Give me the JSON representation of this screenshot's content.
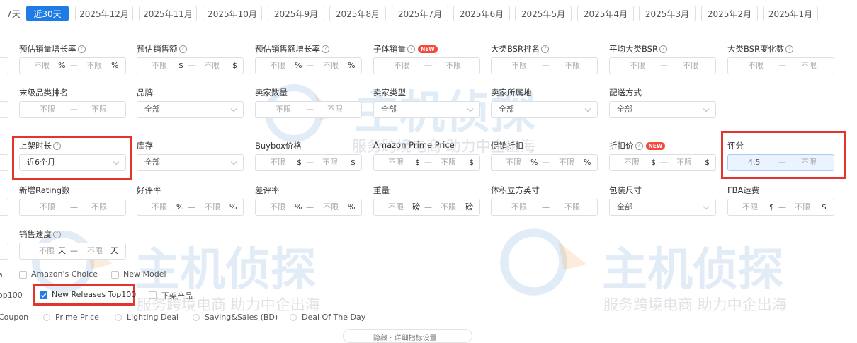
{
  "tabs": [
    "7天",
    "近30天",
    "2025年12月",
    "2025年11月",
    "2025年10月",
    "2025年9月",
    "2025年8月",
    "2025年7月",
    "2025年6月",
    "2025年5月",
    "2025年4月",
    "2025年3月",
    "2025年2月",
    "2025年1月"
  ],
  "active_tab": "近30天",
  "placeholder": "不限",
  "range_dash": "—",
  "placeholder_all": "全部",
  "new_badge": "NEW",
  "filters": {
    "sales_growth_rate": {
      "label": "预估销量增长率",
      "unit": "%"
    },
    "est_revenue": {
      "label": "预估销售额",
      "unit": "$"
    },
    "revenue_growth_rate": {
      "label": "预估销售额增长率",
      "unit": "%"
    },
    "child_sales": {
      "label": "子体销量"
    },
    "main_bsr_rank": {
      "label": "大类BSR排名"
    },
    "avg_main_bsr": {
      "label": "平均大类BSR"
    },
    "main_bsr_change": {
      "label": "大类BSR变化数"
    },
    "leaf_category_rank": {
      "label": "末级品类排名"
    },
    "brand": {
      "label": "品牌"
    },
    "seller_count": {
      "label": "卖家数量"
    },
    "seller_type": {
      "label": "卖家类型"
    },
    "seller_location": {
      "label": "卖家所属地"
    },
    "fulfillment": {
      "label": "配送方式"
    },
    "listing_age": {
      "label": "上架时长",
      "value": "近6个月"
    },
    "inventory": {
      "label": "库存"
    },
    "buybox_price": {
      "label": "Buybox价格",
      "unit": "$"
    },
    "prime_price": {
      "label": "Amazon Prime Price",
      "unit": "$"
    },
    "promo_discount": {
      "label": "促销折扣",
      "unit": "%"
    },
    "discount_price": {
      "label": "折扣价",
      "unit": "$"
    },
    "rating": {
      "label": "评分",
      "min": "4.5"
    },
    "new_rating_count": {
      "label": "新增Rating数"
    },
    "positive_rate": {
      "label": "好评率",
      "unit": "%"
    },
    "negative_rate": {
      "label": "差评率",
      "unit": "%"
    },
    "weight": {
      "label": "重量",
      "unit": "磅"
    },
    "volume": {
      "label": "体积立方英寸"
    },
    "package_size": {
      "label": "包装尺寸"
    },
    "fba_fee": {
      "label": "FBA运费",
      "unit": "$"
    },
    "sales_velocity": {
      "label": "销售速度",
      "unit": "天"
    }
  },
  "checkboxes": {
    "row1": [
      {
        "label": "Amazon's Choice",
        "checked": false
      },
      {
        "label": "New Model",
        "checked": false
      }
    ],
    "row2": [
      {
        "label": "New Releases Top100",
        "checked": true
      },
      {
        "label": "下架产品",
        "checked": false
      }
    ],
    "row1_prefix": "a",
    "row2_prefix": "op100"
  },
  "radios": {
    "prefix": "Coupon",
    "items": [
      "Prime Price",
      "Lighting Deal",
      "Saving&Sales (BD)",
      "Deal Of The Day"
    ]
  },
  "bottom_link": "隐藏 · 详细指标设置",
  "watermark": {
    "brand": "主机侦探",
    "slogan": "服务跨境电商 助力中企出海"
  },
  "colors": {
    "accent": "#1f7be6",
    "highlight": "#e3352d",
    "new_badge": "#f5493d"
  }
}
